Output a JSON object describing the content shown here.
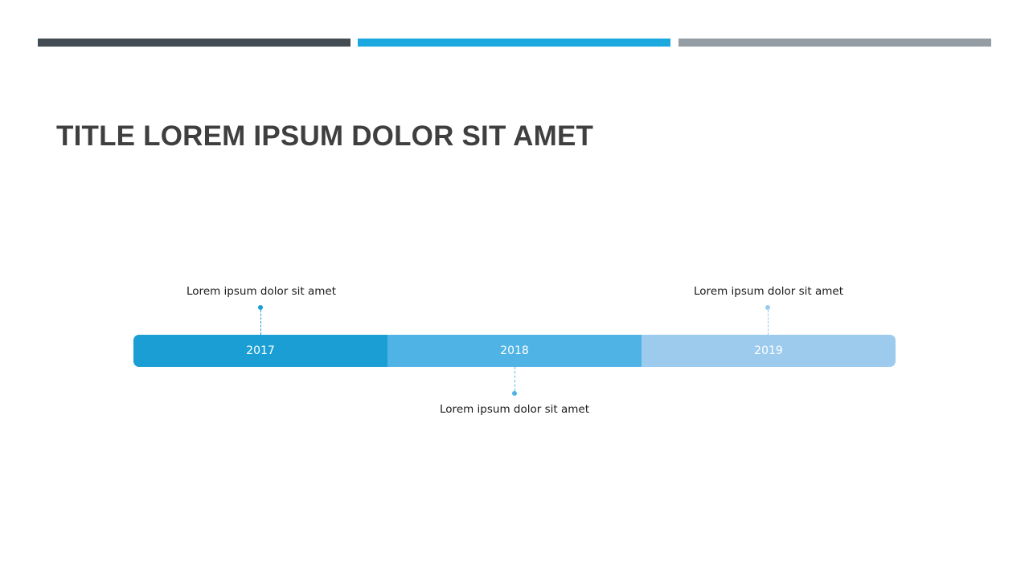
{
  "colors": {
    "bar_dark": "#434c52",
    "bar_accent": "#1aa8de",
    "bar_gray": "#959da4",
    "title": "#3f3f3f"
  },
  "title": "TITLE LOREM IPSUM DOLOR SIT AMET",
  "timeline": {
    "segments": [
      {
        "year": "2017",
        "color": "#1a9ed3"
      },
      {
        "year": "2018",
        "color": "#4fb3e6"
      },
      {
        "year": "2019",
        "color": "#9ccbee"
      }
    ],
    "callouts": [
      {
        "text": "Lorem ipsum dolor sit amet",
        "color": "#1a9ed3"
      },
      {
        "text": "Lorem ipsum dolor sit amet",
        "color": "#4fb3e6"
      },
      {
        "text": "Lorem ipsum dolor sit amet",
        "color": "#9ccbee"
      }
    ]
  }
}
